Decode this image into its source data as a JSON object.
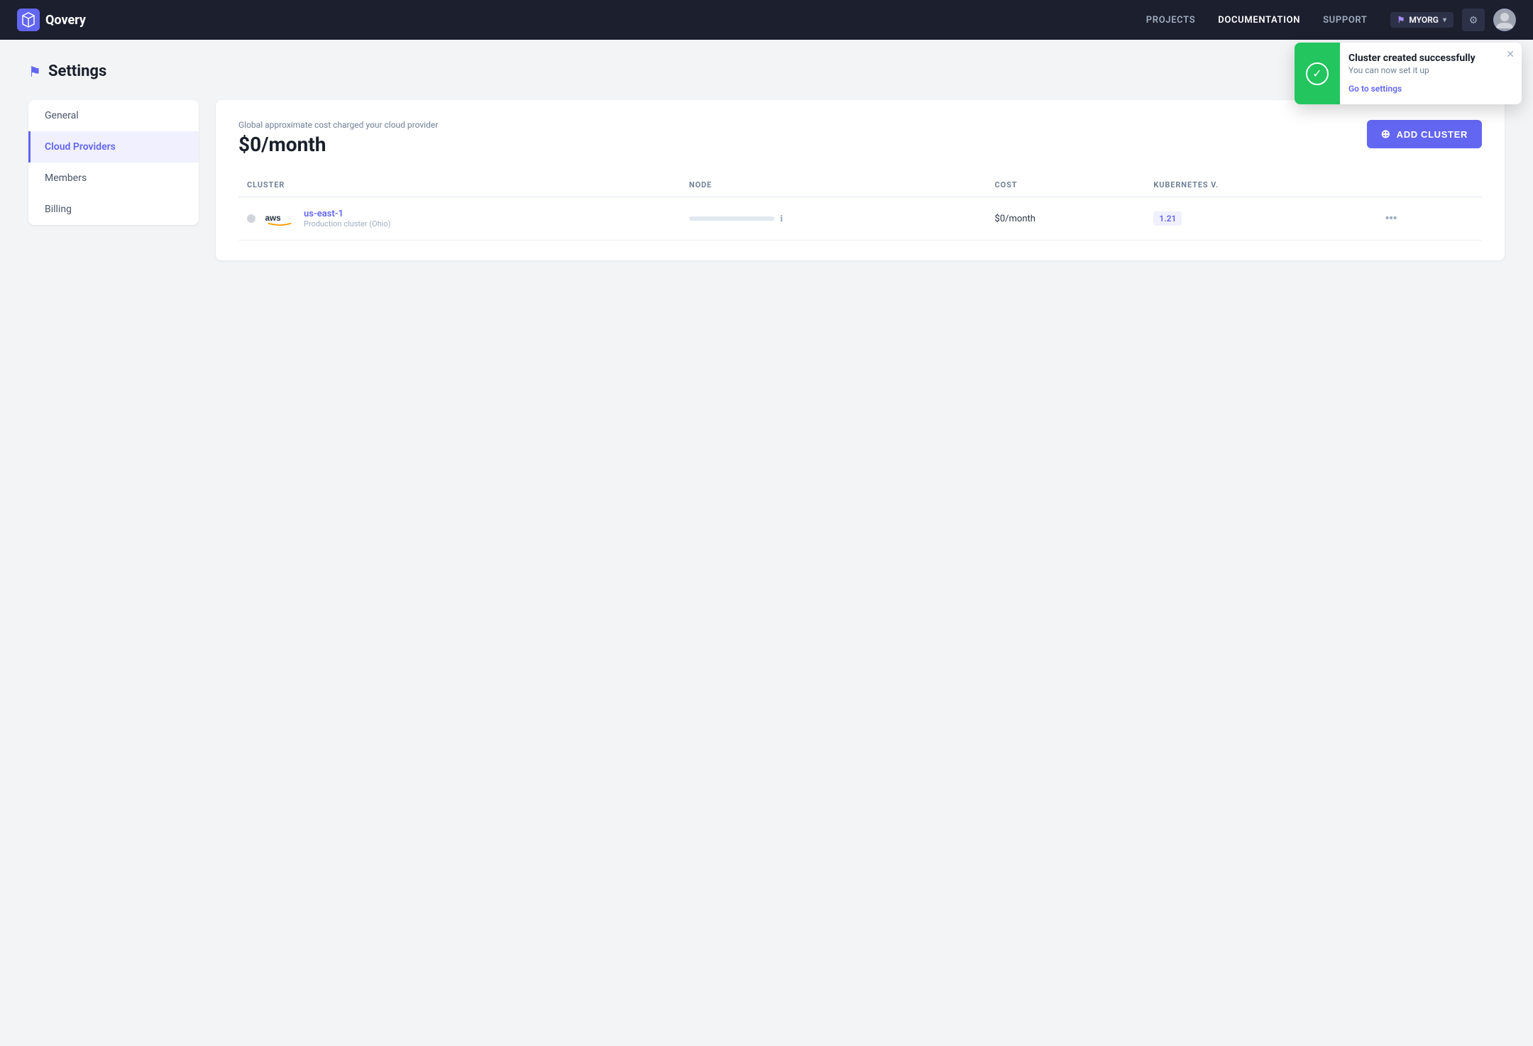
{
  "brand": {
    "name": "Qovery"
  },
  "navbar": {
    "links": [
      {
        "id": "projects",
        "label": "PROJECTS",
        "active": false
      },
      {
        "id": "documentation",
        "label": "DOCUMENTATION",
        "active": true
      },
      {
        "id": "support",
        "label": "SUPPORT",
        "active": false
      }
    ],
    "org_label": "MYORG",
    "gear_icon": "⚙",
    "chevron_icon": "▾"
  },
  "toast": {
    "title": "Cluster created successfully",
    "subtitle": "You can now set it up",
    "link_label": "Go to settings",
    "close_icon": "✕"
  },
  "page_title": "Settings",
  "sidebar": {
    "items": [
      {
        "id": "general",
        "label": "General",
        "active": false
      },
      {
        "id": "cloud-providers",
        "label": "Cloud Providers",
        "active": true
      },
      {
        "id": "members",
        "label": "Members",
        "active": false
      },
      {
        "id": "billing",
        "label": "Billing",
        "active": false
      }
    ]
  },
  "main": {
    "cost_label": "Global approximate cost charged your cloud provider",
    "cost_amount": "$0/month",
    "add_cluster_label": "ADD CLUSTER",
    "table": {
      "headers": [
        "CLUSTER",
        "NODE",
        "COST",
        "KUBERNETES V."
      ],
      "rows": [
        {
          "status": "inactive",
          "provider": "aws",
          "cluster_name": "us-east-1",
          "cluster_region": "Production cluster (Ohio)",
          "node_fill": 0,
          "cost": "$0/month",
          "kubernetes_version": "1.21"
        }
      ]
    }
  }
}
